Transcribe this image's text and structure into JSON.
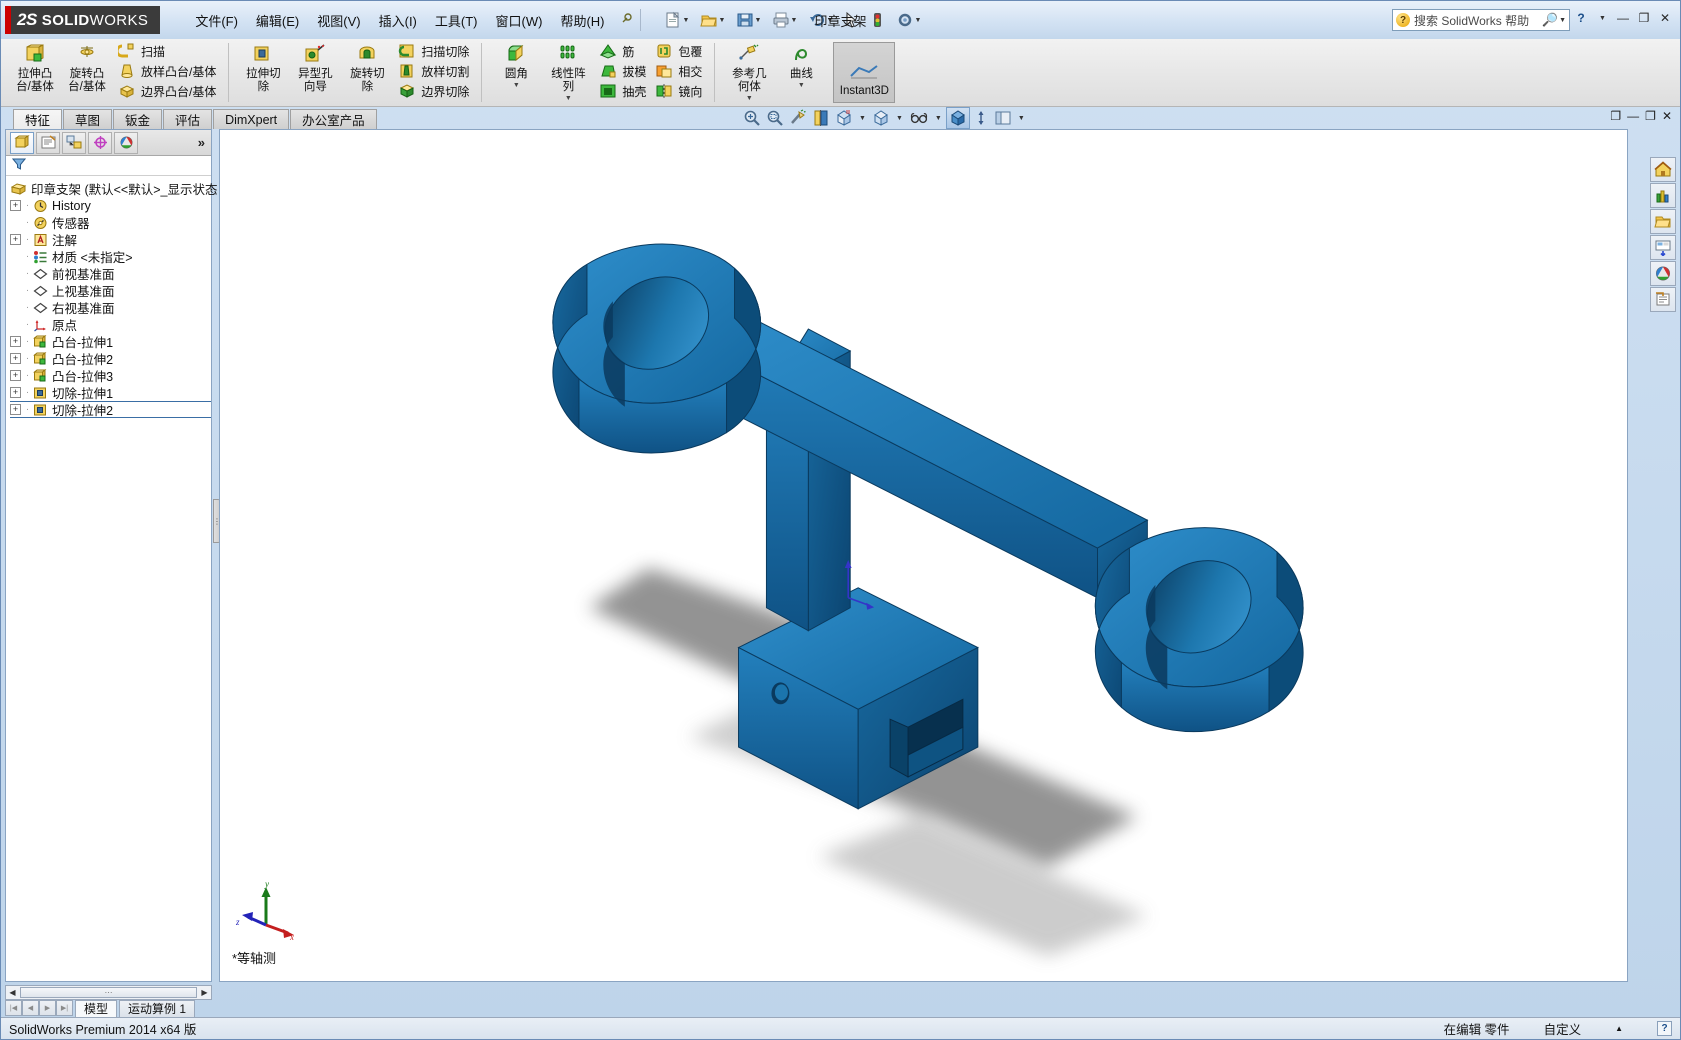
{
  "app": {
    "brand_ds": "2S",
    "brand_name_bold": "SOLID",
    "brand_name_light": "WORKS",
    "document_title": "印章支架",
    "version_status": "SolidWorks Premium 2014 x64 版"
  },
  "menubar": {
    "items": [
      {
        "label": "文件(F)",
        "name": "menu-file"
      },
      {
        "label": "编辑(E)",
        "name": "menu-edit"
      },
      {
        "label": "视图(V)",
        "name": "menu-view"
      },
      {
        "label": "插入(I)",
        "name": "menu-insert"
      },
      {
        "label": "工具(T)",
        "name": "menu-tools"
      },
      {
        "label": "窗口(W)",
        "name": "menu-window"
      },
      {
        "label": "帮助(H)",
        "name": "menu-help"
      }
    ]
  },
  "quick_access": {
    "buttons": [
      {
        "name": "new-document-button",
        "icon": "new-doc-icon"
      },
      {
        "name": "open-document-button",
        "icon": "open-folder-icon"
      },
      {
        "name": "save-button",
        "icon": "save-disk-icon"
      },
      {
        "name": "print-button",
        "icon": "printer-icon"
      },
      {
        "name": "undo-button",
        "icon": "undo-arrow-icon"
      },
      {
        "name": "select-button",
        "icon": "cursor-arrow-icon"
      },
      {
        "name": "rebuild-button",
        "icon": "traffic-light-icon"
      },
      {
        "name": "options-button",
        "icon": "gear-icon"
      }
    ]
  },
  "search": {
    "placeholder": "搜索 SolidWorks 帮助",
    "value": ""
  },
  "window_buttons": {
    "minimize": "—",
    "restore": "❐",
    "close": "✕",
    "help": "?"
  },
  "ribbon": {
    "groups": [
      {
        "name": "features-group-1",
        "big_buttons": [
          {
            "label": "拉伸凸\n台/基体",
            "name": "extruded-boss-base-button",
            "icon": "extrude-boss-icon"
          },
          {
            "label": "旋转凸\n台/基体",
            "name": "revolved-boss-base-button",
            "icon": "revolve-boss-icon"
          }
        ],
        "small_buttons": [
          {
            "label": "扫描",
            "name": "swept-boss-button",
            "icon": "sweep-icon"
          },
          {
            "label": "放样凸台/基体",
            "name": "lofted-boss-button",
            "icon": "loft-icon"
          },
          {
            "label": "边界凸台/基体",
            "name": "boundary-boss-button",
            "icon": "boundary-icon"
          }
        ]
      },
      {
        "name": "features-group-2",
        "big_buttons": [
          {
            "label": "拉伸切\n除",
            "name": "extruded-cut-button",
            "icon": "extrude-cut-icon"
          },
          {
            "label": "异型孔\n向导",
            "name": "hole-wizard-button",
            "icon": "hole-wizard-icon"
          },
          {
            "label": "旋转切\n除",
            "name": "revolved-cut-button",
            "icon": "revolve-cut-icon"
          }
        ],
        "small_buttons": [
          {
            "label": "扫描切除",
            "name": "swept-cut-button",
            "icon": "sweep-cut-icon"
          },
          {
            "label": "放样切割",
            "name": "lofted-cut-button",
            "icon": "loft-cut-icon"
          },
          {
            "label": "边界切除",
            "name": "boundary-cut-button",
            "icon": "boundary-cut-icon"
          }
        ]
      },
      {
        "name": "features-group-3",
        "big_buttons": [
          {
            "label": "圆角",
            "name": "fillet-button",
            "icon": "fillet-icon",
            "has_caret": true
          },
          {
            "label": "线性阵\n列",
            "name": "linear-pattern-button",
            "icon": "linear-pattern-icon",
            "has_caret": true
          }
        ],
        "small_buttons": [
          {
            "label": "筋",
            "name": "rib-button",
            "icon": "rib-icon"
          },
          {
            "label": "拔模",
            "name": "draft-button",
            "icon": "draft-icon"
          },
          {
            "label": "抽壳",
            "name": "shell-button",
            "icon": "shell-icon"
          }
        ],
        "small_buttons_2": [
          {
            "label": "包覆",
            "name": "wrap-button",
            "icon": "wrap-icon"
          },
          {
            "label": "相交",
            "name": "intersect-button",
            "icon": "intersect-icon"
          },
          {
            "label": "镜向",
            "name": "mirror-button",
            "icon": "mirror-icon"
          }
        ]
      },
      {
        "name": "reference-group",
        "big_buttons": [
          {
            "label": "参考几\n何体",
            "name": "reference-geometry-button",
            "icon": "reference-geometry-icon",
            "has_caret": true
          },
          {
            "label": "曲线",
            "name": "curves-button",
            "icon": "curve-icon",
            "has_caret": true
          }
        ]
      }
    ],
    "instant3d": {
      "label": "Instant3D",
      "name": "instant3d-button",
      "active": true
    }
  },
  "command_tabs": {
    "items": [
      {
        "label": "特征",
        "name": "tab-features",
        "active": true
      },
      {
        "label": "草图",
        "name": "tab-sketch",
        "active": false
      },
      {
        "label": "钣金",
        "name": "tab-sheetmetal",
        "active": false
      },
      {
        "label": "评估",
        "name": "tab-evaluate",
        "active": false
      },
      {
        "label": "DimXpert",
        "name": "tab-dimxpert",
        "active": false
      },
      {
        "label": "办公室产品",
        "name": "tab-office-products",
        "active": false
      }
    ]
  },
  "feature_manager": {
    "panel_tabs": [
      {
        "name": "feature-manager-tab",
        "icon": "feature-tree-icon",
        "selected": true
      },
      {
        "name": "property-manager-tab",
        "icon": "property-page-icon",
        "selected": false
      },
      {
        "name": "configuration-manager-tab",
        "icon": "configuration-icon",
        "selected": false
      },
      {
        "name": "dimxpert-manager-tab",
        "icon": "dimxpert-target-icon",
        "selected": false
      },
      {
        "name": "display-manager-tab",
        "icon": "appearance-sphere-icon",
        "selected": false
      }
    ],
    "more_tabs_label": "»",
    "filter_icon": "filter-funnel-icon",
    "tree": [
      {
        "label": "印章支架  (默认<<默认>_显示状态",
        "name": "tree-root-part",
        "icon": "part-icon",
        "expandable": false,
        "indent": 0
      },
      {
        "label": "History",
        "name": "tree-item-history",
        "icon": "history-clock-icon",
        "expandable": true,
        "indent": 1
      },
      {
        "label": "传感器",
        "name": "tree-item-sensors",
        "icon": "sensor-icon",
        "expandable": false,
        "indent": 1
      },
      {
        "label": "注解",
        "name": "tree-item-annotations",
        "icon": "annotations-a-icon",
        "expandable": true,
        "indent": 1
      },
      {
        "label": "材质 <未指定>",
        "name": "tree-item-material",
        "icon": "material-icon",
        "expandable": false,
        "indent": 1
      },
      {
        "label": "前视基准面",
        "name": "tree-item-front-plane",
        "icon": "plane-icon",
        "expandable": false,
        "indent": 1
      },
      {
        "label": "上视基准面",
        "name": "tree-item-top-plane",
        "icon": "plane-icon",
        "expandable": false,
        "indent": 1
      },
      {
        "label": "右视基准面",
        "name": "tree-item-right-plane",
        "icon": "plane-icon",
        "expandable": false,
        "indent": 1
      },
      {
        "label": "原点",
        "name": "tree-item-origin",
        "icon": "origin-icon",
        "expandable": false,
        "indent": 1
      },
      {
        "label": "凸台-拉伸1",
        "name": "tree-item-boss-extrude-1",
        "icon": "boss-extrude-icon",
        "expandable": true,
        "indent": 1
      },
      {
        "label": "凸台-拉伸2",
        "name": "tree-item-boss-extrude-2",
        "icon": "boss-extrude-icon",
        "expandable": true,
        "indent": 1
      },
      {
        "label": "凸台-拉伸3",
        "name": "tree-item-boss-extrude-3",
        "icon": "boss-extrude-icon",
        "expandable": true,
        "indent": 1
      },
      {
        "label": "切除-拉伸1",
        "name": "tree-item-cut-extrude-1",
        "icon": "cut-extrude-icon",
        "expandable": true,
        "indent": 1
      },
      {
        "label": "切除-拉伸2",
        "name": "tree-item-cut-extrude-2",
        "icon": "cut-extrude-icon",
        "expandable": true,
        "indent": 1,
        "rollback_bar": true
      }
    ]
  },
  "view_toolbar": {
    "buttons": [
      {
        "name": "zoom-to-fit-button",
        "icon": "zoom-fit-magnifier-icon"
      },
      {
        "name": "zoom-to-area-button",
        "icon": "zoom-area-magnifier-icon"
      },
      {
        "name": "previous-view-button",
        "icon": "previous-view-icon"
      },
      {
        "name": "section-view-button",
        "icon": "section-view-icon"
      },
      {
        "name": "view-orientation-button",
        "icon": "view-orientation-cube-icon",
        "has_caret": true
      },
      {
        "name": "display-style-button",
        "icon": "display-style-cube-icon",
        "has_caret": true
      },
      {
        "name": "hide-show-items-button",
        "icon": "glasses-icon",
        "has_caret": true
      },
      {
        "name": "apply-scene-button",
        "icon": "scene-cube-icon",
        "selected": true
      },
      {
        "name": "view-settings-button",
        "icon": "view-settings-icon"
      },
      {
        "name": "display-pane-button",
        "icon": "display-pane-icon",
        "has_caret": true
      }
    ]
  },
  "graphics": {
    "view_label": "*等轴测",
    "triad_axes": {
      "x": "x",
      "y": "y",
      "z": "z"
    },
    "model_colors": {
      "body_light": "#1a78b8",
      "body_mid": "#1568a4",
      "body_dark": "#0d4f80",
      "body_darkest": "#0a3d64",
      "highlight": "#4ba6dd",
      "shadow": "#9a9a9a"
    }
  },
  "document_window_buttons": {
    "restore": "❐",
    "minimize": "—",
    "maximize": "❐",
    "close": "✕"
  },
  "task_pane": {
    "buttons": [
      {
        "name": "task-pane-resources-button",
        "icon": "home-house-icon"
      },
      {
        "name": "task-pane-design-library-button",
        "icon": "design-library-icon"
      },
      {
        "name": "task-pane-file-explorer-button",
        "icon": "folder-icon"
      },
      {
        "name": "task-pane-view-palette-button",
        "icon": "view-palette-icon"
      },
      {
        "name": "task-pane-appearances-button",
        "icon": "appearance-sphere-icon"
      },
      {
        "name": "task-pane-custom-properties-button",
        "icon": "custom-properties-icon"
      }
    ]
  },
  "document_tabs": {
    "nav": [
      "|◀",
      "◀",
      "▶",
      "▶|"
    ],
    "tabs": [
      {
        "label": "模型",
        "name": "doc-tab-model",
        "active": true
      },
      {
        "label": "运动算例 1",
        "name": "doc-tab-motion-study",
        "active": false
      }
    ]
  },
  "statusbar": {
    "left": "SolidWorks Premium 2014 x64 版",
    "editing": "在编辑 零件",
    "custom": "自定义",
    "caret": "▲",
    "help": "?"
  },
  "scrollbar": {
    "left_arrow": "◀",
    "right_arrow": "▶",
    "grip": "⋯"
  }
}
